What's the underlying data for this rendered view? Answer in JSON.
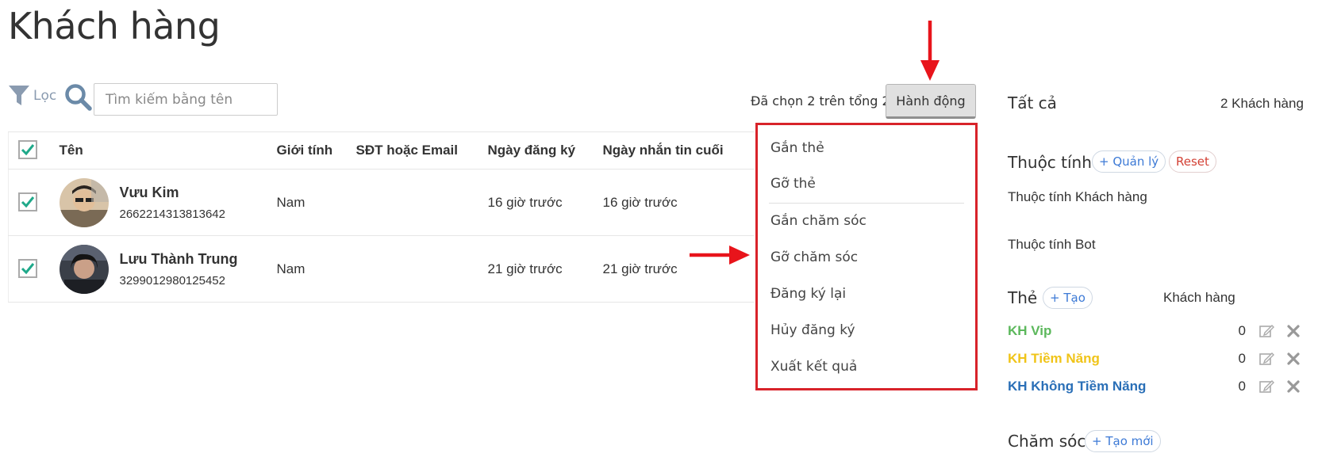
{
  "page": {
    "title": "Khách hàng"
  },
  "toolbar": {
    "filter_label": "Lọc",
    "search_placeholder": "Tìm kiếm bằng tên",
    "selected_summary": "Đã chọn 2 trên tổng 2",
    "action_label": "Hành động"
  },
  "table": {
    "headers": [
      "Tên",
      "Giới tính",
      "SĐT hoặc Email",
      "Ngày đăng ký",
      "Ngày nhắn tin cuối"
    ],
    "rows": [
      {
        "name": "Vưu Kim",
        "id": "2662214313813642",
        "gender": "Nam",
        "contact": "",
        "registered": "16 giờ trước",
        "last_message": "16 giờ trước"
      },
      {
        "name": "Lưu Thành Trung",
        "id": "3299012980125452",
        "gender": "Nam",
        "contact": "",
        "registered": "21 giờ trước",
        "last_message": "21 giờ trước"
      }
    ]
  },
  "action_menu": {
    "items": [
      "Gắn thẻ",
      "Gỡ thẻ",
      "Gắn chăm sóc",
      "Gỡ chăm sóc",
      "Đăng ký lại",
      "Hủy đăng ký",
      "Xuất kết quả"
    ]
  },
  "sidebar": {
    "all_label": "Tất cả",
    "all_count": "2 Khách hàng",
    "attributes_label": "Thuộc tính",
    "manage_label": "+ Quản lý",
    "reset_label": "Reset",
    "customer_attributes": "Thuộc tính Khách hàng",
    "bot_attributes": "Thuộc tính Bot",
    "tags_label": "Thẻ",
    "create_label": "+ Tạo",
    "customers_header": "Khách hàng",
    "tags": [
      {
        "name": "KH Vip",
        "count": "0",
        "color": "#5cb85c"
      },
      {
        "name": "KH Tiềm Năng",
        "count": "0",
        "color": "#f0c419"
      },
      {
        "name": "KH Không Tiềm Năng",
        "count": "0",
        "color": "#2a6fb7"
      }
    ],
    "care_label": "Chăm sóc",
    "create_new_label": "+ Tạo mới"
  },
  "colors": {
    "accent_red": "#d8232a",
    "check_green": "#1fa98a"
  }
}
